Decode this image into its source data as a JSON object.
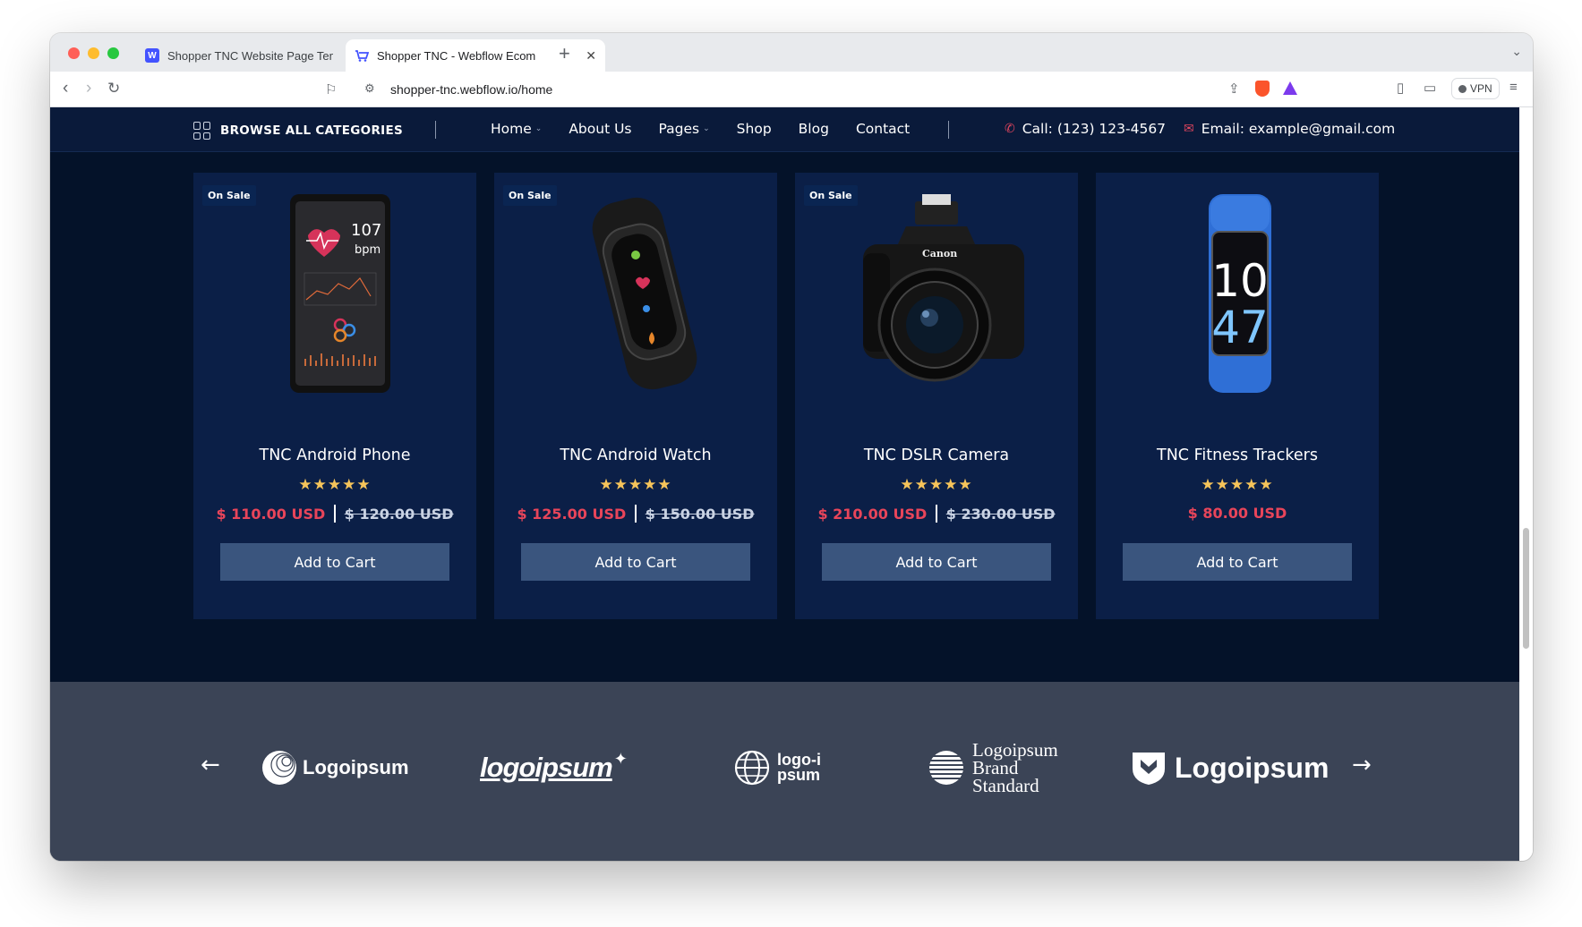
{
  "browser": {
    "tabs": [
      {
        "title": "Shopper TNC Website Page Temp",
        "active": false
      },
      {
        "title": "Shopper TNC - Webflow Ecom",
        "active": true
      }
    ],
    "url": "shopper-tnc.webflow.io/home",
    "vpn_label": "VPN"
  },
  "nav": {
    "categories_label": "BROWSE ALL CATEGORIES",
    "menu": [
      {
        "label": "Home",
        "dropdown": true
      },
      {
        "label": "About Us",
        "dropdown": false
      },
      {
        "label": "Pages",
        "dropdown": true
      },
      {
        "label": "Shop",
        "dropdown": false
      },
      {
        "label": "Blog",
        "dropdown": false
      },
      {
        "label": "Contact",
        "dropdown": false
      }
    ],
    "phone": "Call: (123) 123-4567",
    "email": "Email: example@gmail.com"
  },
  "products": [
    {
      "badge": "On Sale",
      "name": "TNC Android Phone",
      "rating": 5,
      "price": "$ 110.00 USD",
      "old_price": "$ 120.00 USD",
      "button": "Add to Cart",
      "screen_bpm": "107",
      "screen_unit": "bpm"
    },
    {
      "badge": "On Sale",
      "name": "TNC Android Watch",
      "rating": 5,
      "price": "$ 125.00 USD",
      "old_price": "$ 150.00 USD",
      "button": "Add to Cart"
    },
    {
      "badge": "On Sale",
      "name": "TNC DSLR Camera",
      "rating": 5,
      "price": "$ 210.00 USD",
      "old_price": "$ 230.00 USD",
      "button": "Add to Cart",
      "brand_text": "Canon"
    },
    {
      "badge": "",
      "name": "TNC Fitness Trackers",
      "rating": 5,
      "price": "$ 80.00 USD",
      "old_price": "",
      "button": "Add to Cart",
      "display_hour": "10",
      "display_min": "47"
    }
  ],
  "logos": {
    "items": [
      "Logoipsum",
      "logoipsum",
      "logo-ipsum",
      "Logoipsum Brand Standard",
      "Logoipsum"
    ],
    "prev_arrow": "←",
    "next_arrow": "→"
  },
  "colors": {
    "page_bg": "#041229",
    "nav_bg": "#0a1a3a",
    "card_bg": "#0b1f47",
    "price_accent": "#e8455a",
    "star": "#f6c45a",
    "button_bg": "#3a557e",
    "logos_bg": "#3b4456"
  }
}
